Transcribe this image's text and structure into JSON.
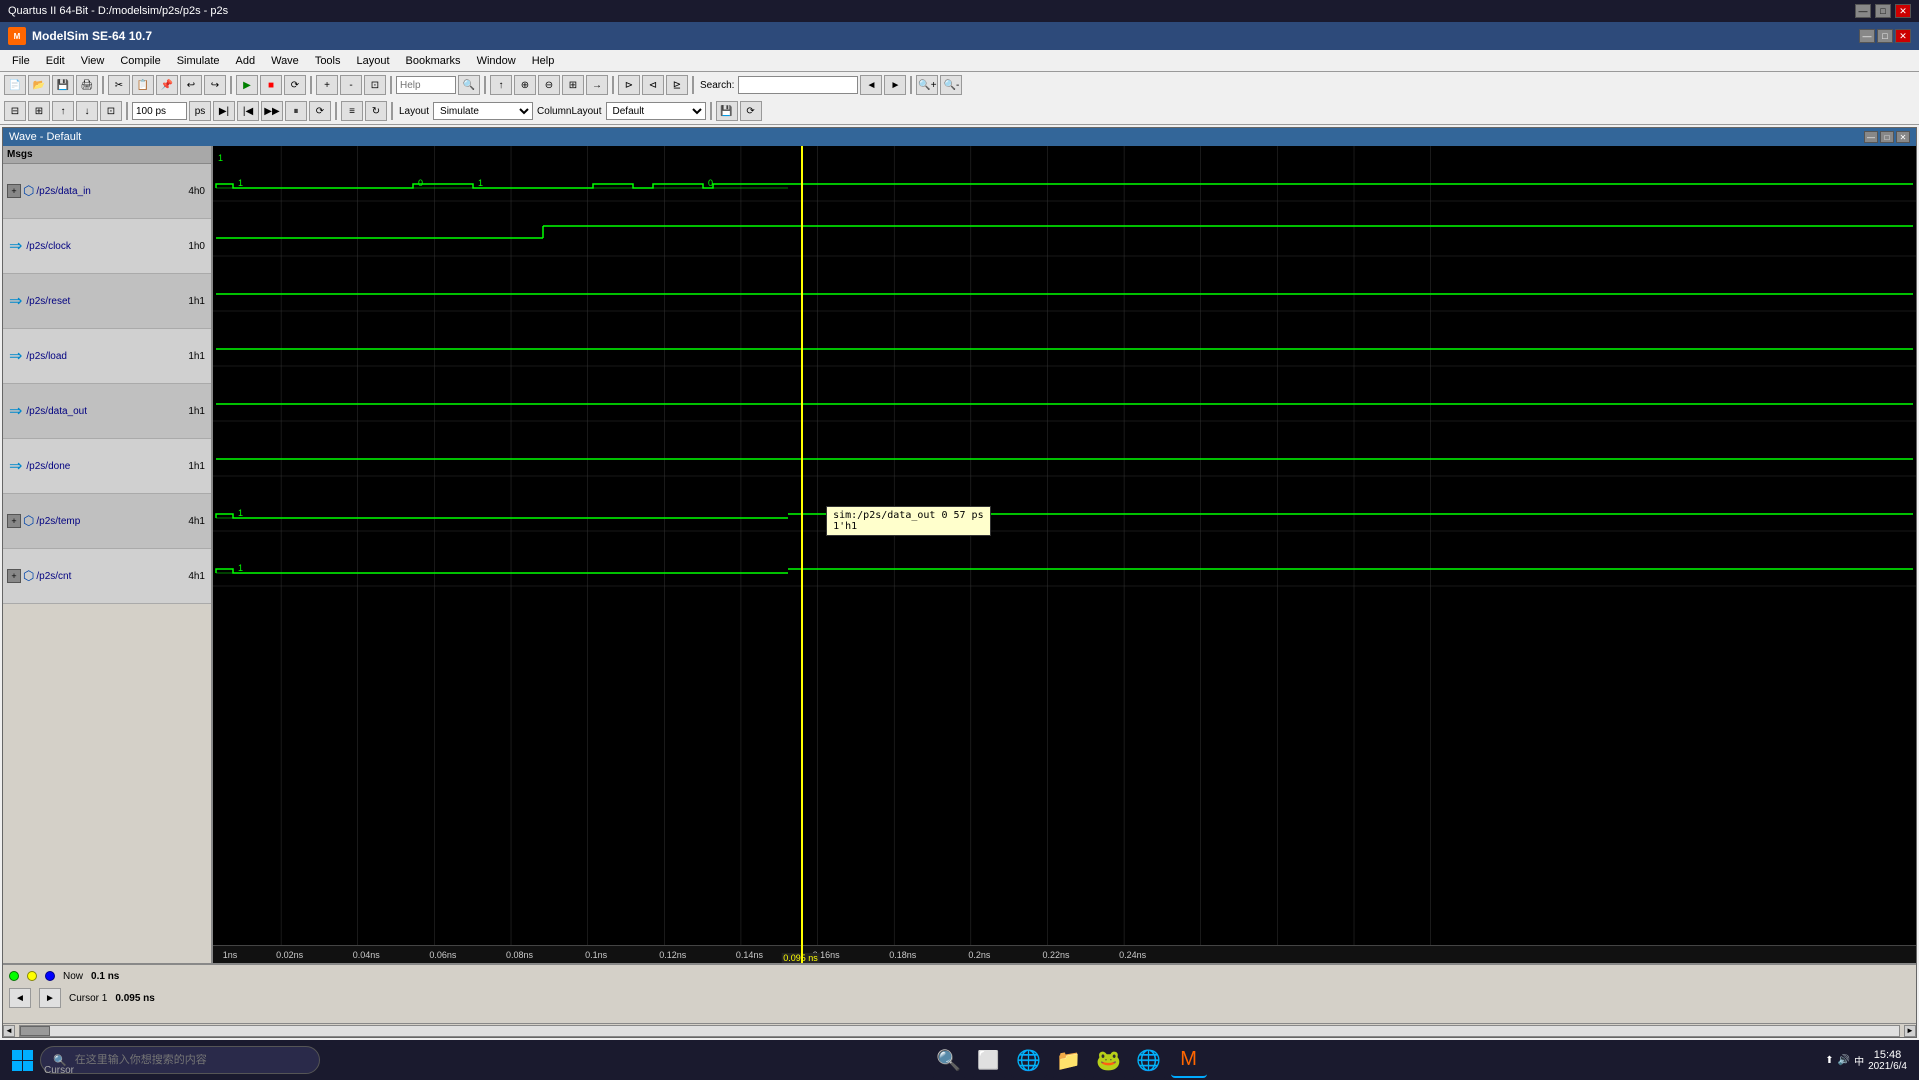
{
  "titlebar": {
    "label": "Quartus II 64-Bit - D:/modelsim/p2s/p2s - p2s",
    "minimize": "—",
    "maximize": "□",
    "close": "✕"
  },
  "app": {
    "title": "ModelSim SE-64 10.7",
    "logo": "M"
  },
  "menus": [
    "File",
    "Edit",
    "View",
    "Compile",
    "Simulate",
    "Add",
    "Wave",
    "Tools",
    "Layout",
    "Bookmarks",
    "Window",
    "Help"
  ],
  "wave_title": "Wave - Default",
  "signals": [
    {
      "name": "/p2s/data_in",
      "value": "4h0",
      "type": "bus",
      "has_expand": true
    },
    {
      "name": "/p2s/clock",
      "value": "1h0",
      "type": "single",
      "has_expand": false
    },
    {
      "name": "/p2s/reset",
      "value": "1h1",
      "type": "single",
      "has_expand": false
    },
    {
      "name": "/p2s/load",
      "value": "1h1",
      "type": "single",
      "has_expand": false
    },
    {
      "name": "/p2s/data_out",
      "value": "1h1",
      "type": "single",
      "has_expand": false
    },
    {
      "name": "/p2s/done",
      "value": "1h1",
      "type": "single",
      "has_expand": false
    },
    {
      "name": "/p2s/temp",
      "value": "4h1",
      "type": "bus",
      "has_expand": true
    },
    {
      "name": "/p2s/cnt",
      "value": "4h1",
      "type": "bus",
      "has_expand": true
    }
  ],
  "time_markers": [
    "1ns",
    "0.02ns",
    "0.04ns",
    "0.06ns",
    "0.08ns",
    "0.1ns",
    "0.12ns",
    "0.14ns",
    "0.16ns",
    "0.18ns",
    "0.2ns",
    "0.22ns",
    "0.24ns"
  ],
  "cursor": {
    "position_label": "Cursor 1",
    "time": "0.095 ns",
    "line_x_pct": 34.5
  },
  "tooltip": {
    "text_line1": "sim:/p2s/data_out 0 57 ps",
    "text_line2": "1'h1"
  },
  "status": {
    "now_label": "Now",
    "now_value": "0.1 ns",
    "cursor_label": "Cursor 1",
    "cursor_value": "0.095 ns"
  },
  "toolbar": {
    "help_placeholder": "Help",
    "sim_time": "100 ps",
    "layout_label": "Layout",
    "layout_value": "Simulate",
    "column_layout_label": "ColumnLayout",
    "column_layout_value": "Default"
  },
  "taskbar": {
    "search_placeholder": "在这里输入你想搜索的内容",
    "time": "15:48",
    "date": "2021/6/4",
    "cursor_label": "Cursor"
  }
}
